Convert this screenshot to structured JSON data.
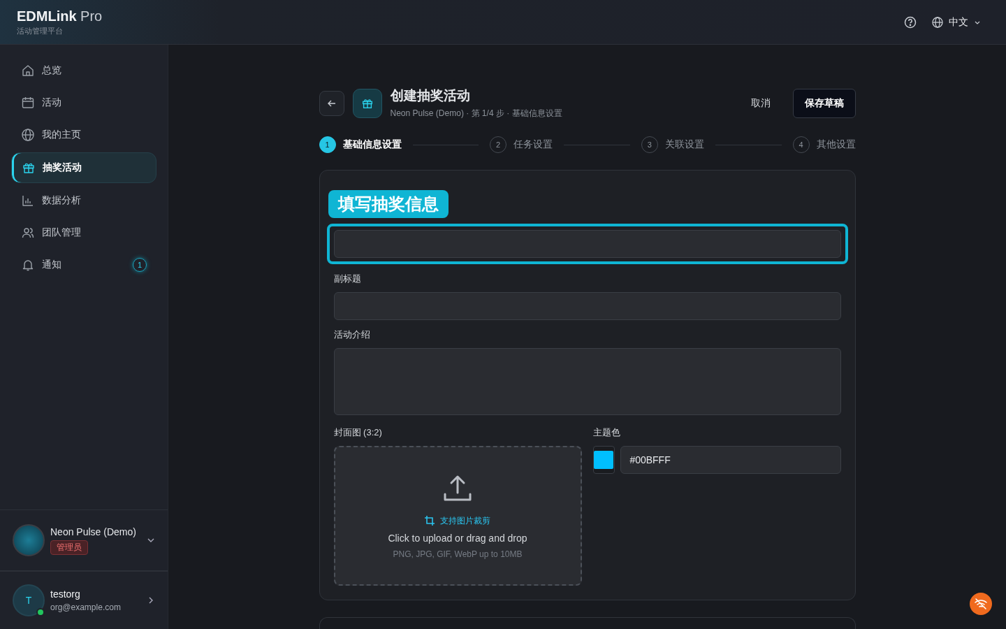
{
  "brand": {
    "name": "EDMLink",
    "suffix": "Pro",
    "subtitle": "活动管理平台"
  },
  "topbar": {
    "language": "中文"
  },
  "sidebar": {
    "items": [
      {
        "label": "总览",
        "selected": false
      },
      {
        "label": "活动",
        "selected": false
      },
      {
        "label": "我的主页",
        "selected": false
      },
      {
        "label": "抽奖活动",
        "selected": true
      },
      {
        "label": "数据分析",
        "selected": false
      },
      {
        "label": "团队管理",
        "selected": false
      },
      {
        "label": "通知",
        "selected": false,
        "badge": "1"
      }
    ],
    "workspace": {
      "name": "Neon Pulse (Demo)",
      "role": "管理员"
    },
    "user": {
      "initial": "T",
      "name": "testorg",
      "email": "org@example.com",
      "online": true
    }
  },
  "page": {
    "title": "创建抽奖活动",
    "subtitle": "Neon Pulse (Demo) · 第 1/4 步 · 基础信息设置",
    "cancel": "取消",
    "save": "保存草稿"
  },
  "steps": [
    {
      "number": "1",
      "label": "基础信息设置",
      "selected": true
    },
    {
      "number": "2",
      "label": "任务设置",
      "selected": false
    },
    {
      "number": "3",
      "label": "关联设置",
      "selected": false
    },
    {
      "number": "4",
      "label": "其他设置",
      "selected": false
    }
  ],
  "form": {
    "tooltip": "填写抽奖信息",
    "subtitle_label": "副标题",
    "intro_label": "活动介绍",
    "cover": {
      "label": "封面图 (3:2)",
      "crop_hint": "支持图片裁剪",
      "prompt": "Click to upload or drag and drop",
      "formats": "PNG, JPG, GIF, WebP up to 10MB"
    },
    "theme_color": {
      "label": "主题色",
      "value": "#00BFFF"
    }
  }
}
